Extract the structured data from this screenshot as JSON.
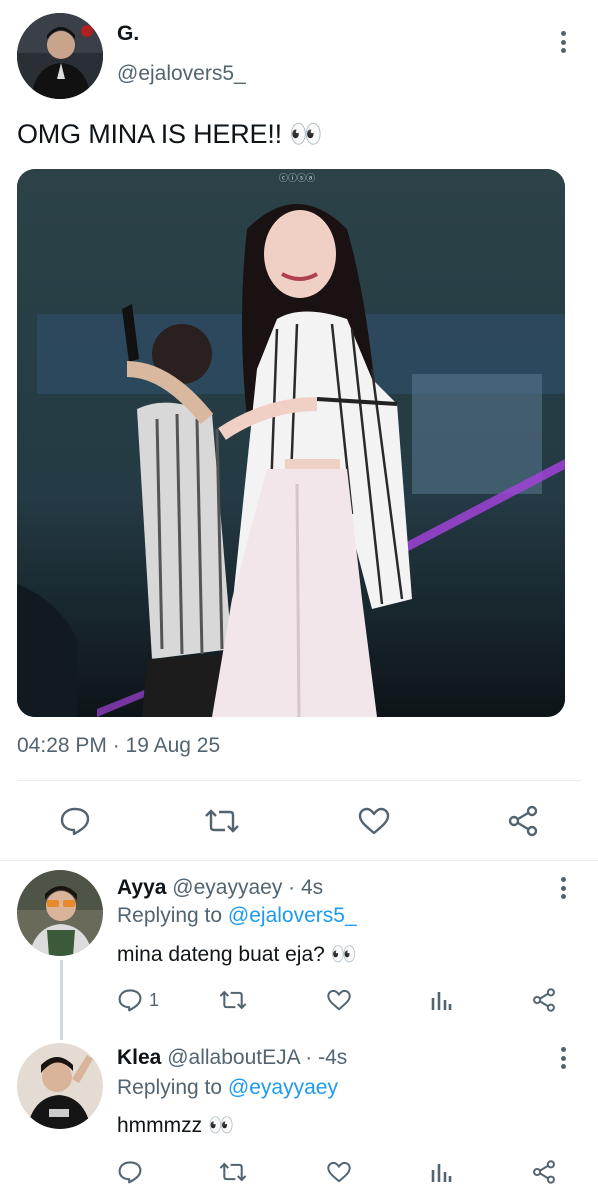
{
  "main_tweet": {
    "display_name": "G.",
    "handle": "@ejalovers5_",
    "text": "OMG MINA IS HERE!! 👀",
    "timestamp": "04:28 PM · 19 Aug 25",
    "media_icon": "concert-photo",
    "actions": [
      "reply-icon",
      "retweet-icon",
      "like-icon",
      "share-icon"
    ]
  },
  "replies": [
    {
      "display_name": "Ayya",
      "handle": "@eyayyaey",
      "time": "· 4s",
      "replying_label": "Replying to",
      "replying_to": "@ejalovers5_",
      "text": "mina dateng buat eja? 👀",
      "reply_count": "1"
    },
    {
      "display_name": "Klea",
      "handle": "@allaboutEJA",
      "time": "· -4s",
      "replying_label": "Replying to",
      "replying_to": "@eyayyaey",
      "text": "hmmmzz 👀",
      "reply_count": ""
    }
  ],
  "colors": {
    "text": "#0f1419",
    "muted": "#536471",
    "link": "#1d9bf0",
    "divider": "#e6ecf0"
  }
}
